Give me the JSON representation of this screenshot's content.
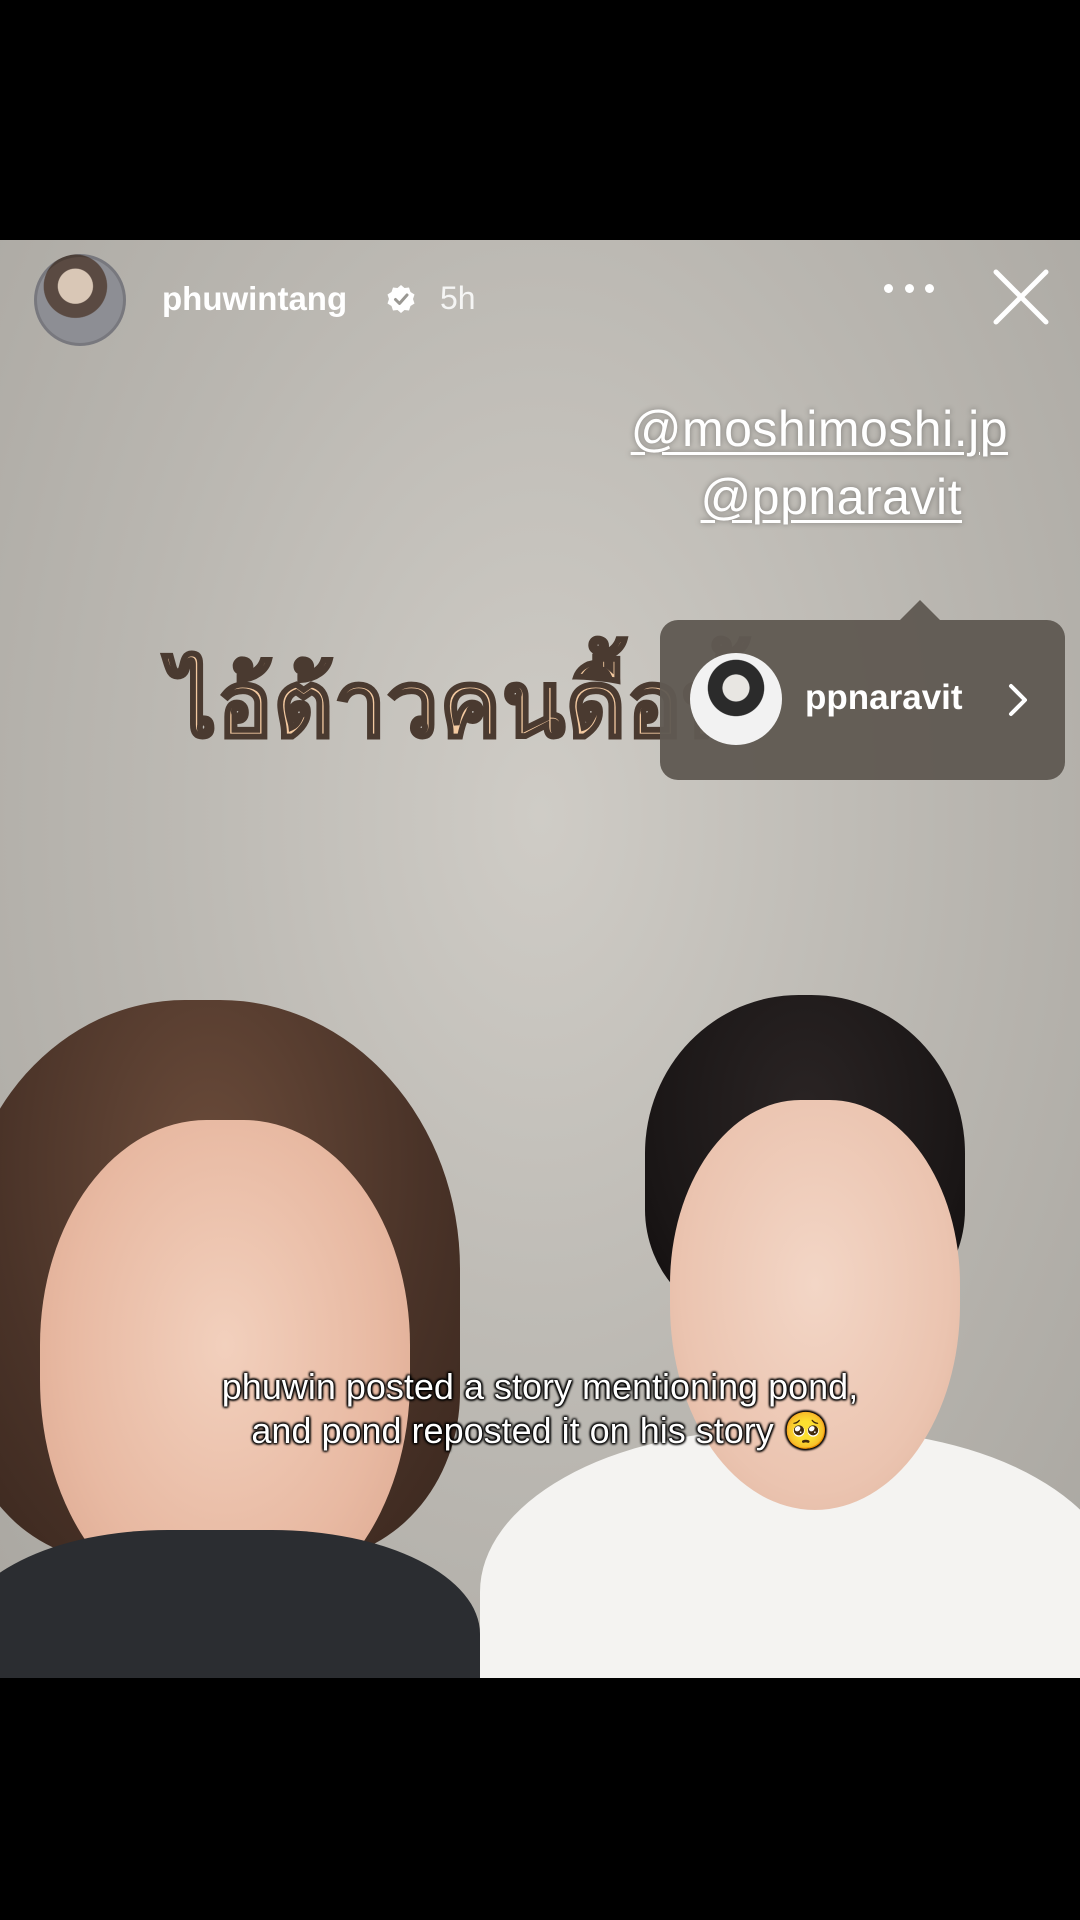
{
  "story": {
    "username": "phuwintang",
    "verified": true,
    "time": "5h",
    "mentions": [
      "@moshimoshi.jp",
      "@ppnaravit"
    ],
    "overlay_text": "ไอ้ต้าวคนดื้อทั้"
  },
  "mention_popup": {
    "username": "ppnaravit"
  },
  "caption": {
    "line1": "phuwin posted a story mentioning pond,",
    "line2": "and pond reposted it on his story 🥺"
  },
  "icons": {
    "verified": "verified-badge-icon",
    "more": "more-options-icon",
    "close": "close-icon",
    "chevron": "chevron-right-icon"
  }
}
